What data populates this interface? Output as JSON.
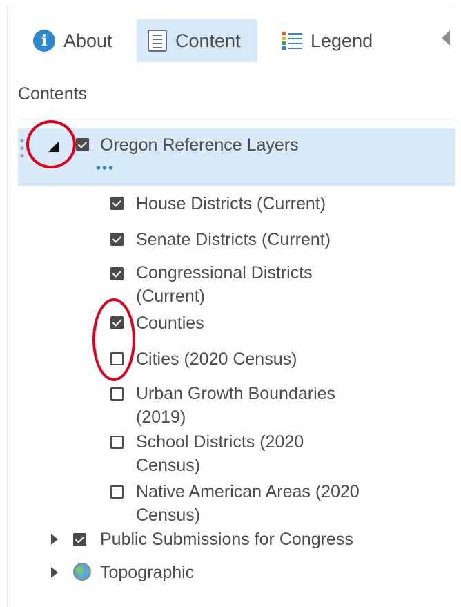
{
  "tabs": [
    {
      "label": "About",
      "icon": "info-icon",
      "active": false
    },
    {
      "label": "Content",
      "icon": "content-list-icon",
      "active": true
    },
    {
      "label": "Legend",
      "icon": "legend-icon",
      "active": false
    }
  ],
  "contents_heading": "Contents",
  "layers": {
    "group": {
      "label": "Oregon Reference Layers",
      "checked": true,
      "expanded": true
    },
    "children": [
      {
        "label": "House Districts (Current)",
        "checked": true
      },
      {
        "label": "Senate Districts (Current)",
        "checked": true
      },
      {
        "label_line1": "Congressional Districts",
        "label_line2": "(Current)",
        "checked": true
      },
      {
        "label": "Counties",
        "checked": true
      },
      {
        "label": "Cities (2020 Census)",
        "checked": false
      },
      {
        "label_line1": "Urban Growth Boundaries",
        "label_line2": "(2019)",
        "checked": false
      },
      {
        "label_line1": "School Districts (2020",
        "label_line2": "Census)",
        "checked": false
      },
      {
        "label_line1": "Native American Areas (2020",
        "label_line2": "Census)",
        "checked": false
      }
    ],
    "others": [
      {
        "label": "Public Submissions for Congress",
        "checked": true,
        "expanded": false
      },
      {
        "label": "Topographic",
        "icon": "globe-icon",
        "expanded": false
      }
    ]
  },
  "colors": {
    "accent": "#2e87c8",
    "selected_bg": "#d8eaf7",
    "annotation": "#e0001b",
    "text": "#4c4c4c"
  }
}
